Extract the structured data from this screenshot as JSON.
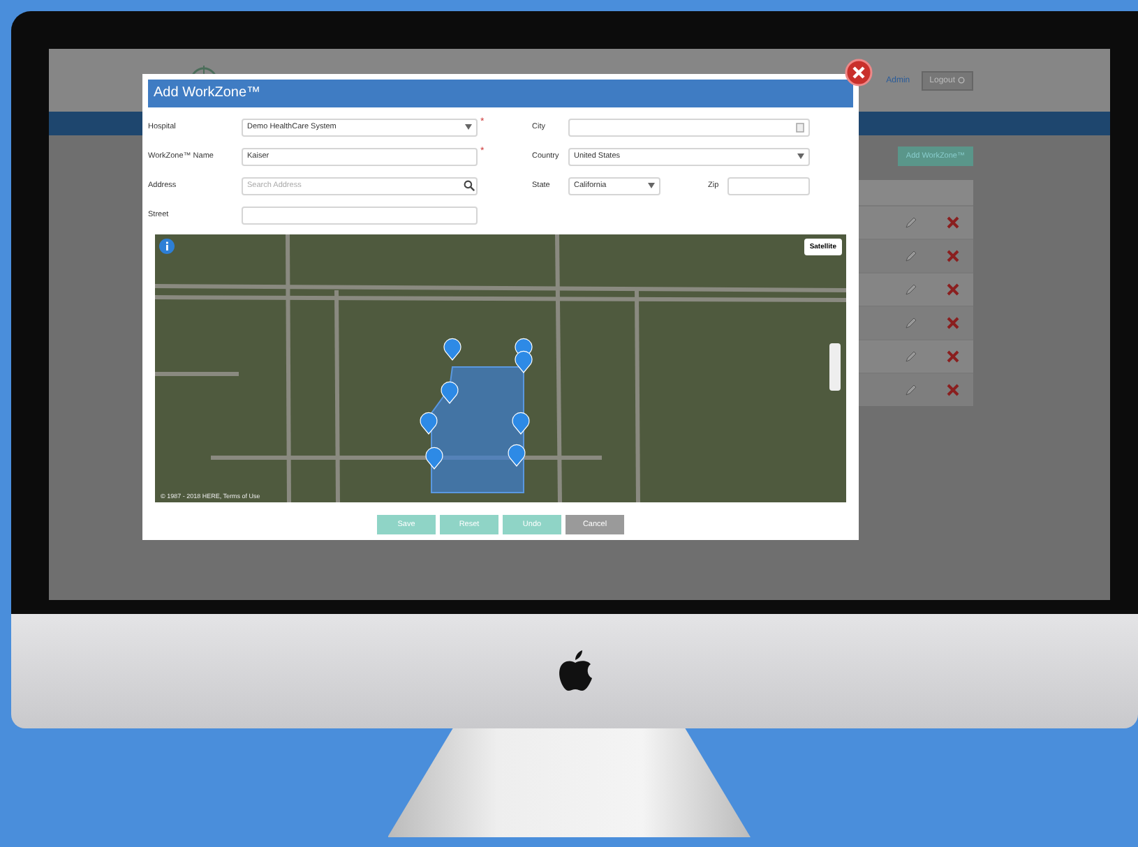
{
  "header": {
    "user_link": "Admin",
    "logout_button": "Logout"
  },
  "toolbar": {
    "add_button": "Add WorkZone™"
  },
  "modal": {
    "title": "Add WorkZone™",
    "left_fields": [
      {
        "label": "Hospital",
        "kind": "select",
        "value": "Demo HealthCare System",
        "mark": "*"
      },
      {
        "label": "WorkZone™ Name",
        "kind": "text",
        "value": "Kaiser",
        "mark": "*"
      },
      {
        "label": "Address",
        "kind": "search",
        "placeholder": "Search Address"
      },
      {
        "label": "Street",
        "kind": "text"
      }
    ],
    "right_fields": [
      {
        "label": "City",
        "kind": "lookup"
      },
      {
        "label": "Country",
        "kind": "select",
        "value": "United States"
      },
      {
        "label": "State",
        "kind": "select",
        "value": "California"
      },
      {
        "label": "Zip",
        "kind": "text"
      }
    ],
    "map": {
      "layer_button": "Satellite",
      "attribution": "© 1987 - 2018 HERE, Terms of Use"
    },
    "buttons": [
      {
        "label": "Save",
        "kind": "primary",
        "disabled": true
      },
      {
        "label": "Reset",
        "kind": "primary",
        "disabled": true
      },
      {
        "label": "Undo",
        "kind": "primary",
        "disabled": true
      },
      {
        "label": "Cancel",
        "kind": "secondary",
        "disabled": false
      }
    ]
  }
}
